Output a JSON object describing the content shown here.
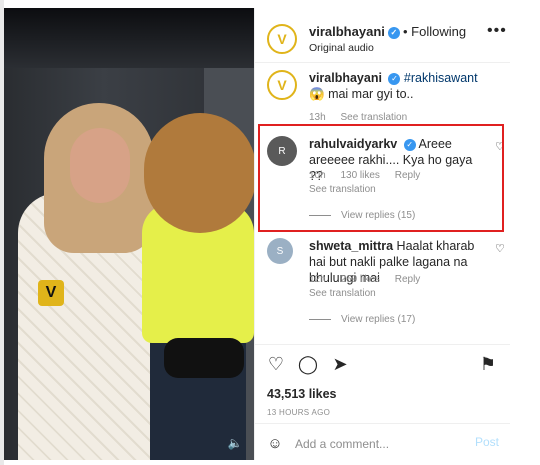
{
  "post": {
    "username": "viralbhayani",
    "following_label": "• Following",
    "audio": "Original audio",
    "more_icon": "more-horizontal-icon"
  },
  "caption": {
    "username": "viralbhayani",
    "hashtag": "#rakhisawant",
    "emoji": "😱",
    "text_tail": "mai mar gyi to..",
    "time": "13h",
    "translation": "See translation"
  },
  "comments": [
    {
      "username": "rahulvaidyarkv",
      "text": "Areee areeeee rakhi.... Kya ho gaya ??",
      "time": "10h",
      "likes": "130 likes",
      "reply": "Reply",
      "translation": "See translation",
      "view_replies": "View replies (15)"
    },
    {
      "username": "shweta_mittra",
      "text": "Haalat kharab hai but nakli palke lagana na bhulungi mai",
      "time": "12h",
      "likes": "269 likes",
      "reply": "Reply",
      "translation": "See translation",
      "view_replies": "View replies (17)"
    }
  ],
  "actions": {
    "like_icon": "heart-icon",
    "comment_icon": "comment-icon",
    "share_icon": "share-icon",
    "save_icon": "bookmark-icon"
  },
  "likes_count": "43,513 likes",
  "timestamp": "13 HOURS AGO",
  "add_comment": {
    "placeholder": "Add a comment...",
    "post_label": "Post"
  },
  "colors": {
    "highlight": "#e02020",
    "verified": "#3897f0",
    "brand_yellow": "#e0b41a"
  }
}
